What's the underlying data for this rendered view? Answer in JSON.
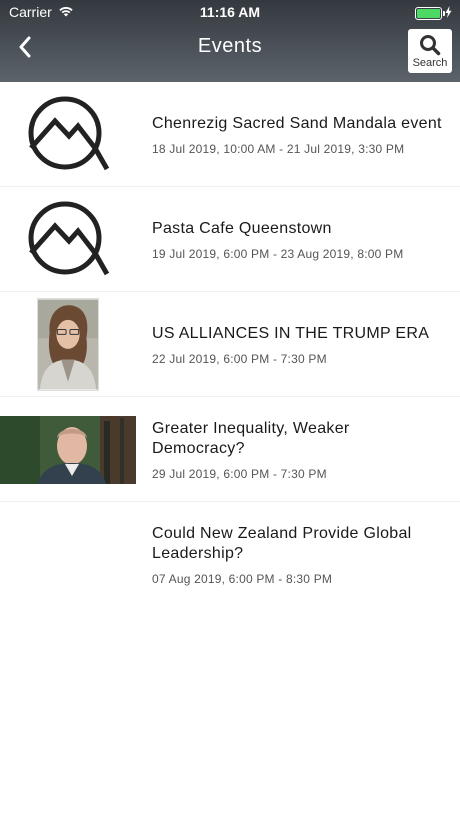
{
  "status_bar": {
    "carrier": "Carrier",
    "time": "11:16 AM"
  },
  "nav": {
    "title": "Events",
    "search_label": "Search"
  },
  "events": [
    {
      "title": "Chenrezig Sacred Sand Mandala event",
      "date": "18 Jul 2019, 10:00 AM - 21 Jul 2019, 3:30 PM",
      "thumb": "logo"
    },
    {
      "title": "Pasta Cafe Queenstown",
      "date": "19 Jul 2019, 6:00 PM - 23 Aug 2019, 8:00 PM",
      "thumb": "logo"
    },
    {
      "title": "US ALLIANCES IN THE TRUMP ERA",
      "date": "22 Jul 2019, 6:00 PM - 7:30 PM",
      "thumb": "photo-woman"
    },
    {
      "title": "Greater Inequality, Weaker Democracy?",
      "date": "29 Jul 2019, 6:00 PM - 7:30 PM",
      "thumb": "photo-man"
    },
    {
      "title": "Could New Zealand Provide Global Leadership?",
      "date": "07 Aug 2019, 6:00 PM - 8:30 PM",
      "thumb": "none"
    }
  ],
  "colors": {
    "header": "#3f454b",
    "battery": "#4cd964",
    "title_text": "#1a1a1a",
    "date_text": "#555555"
  }
}
